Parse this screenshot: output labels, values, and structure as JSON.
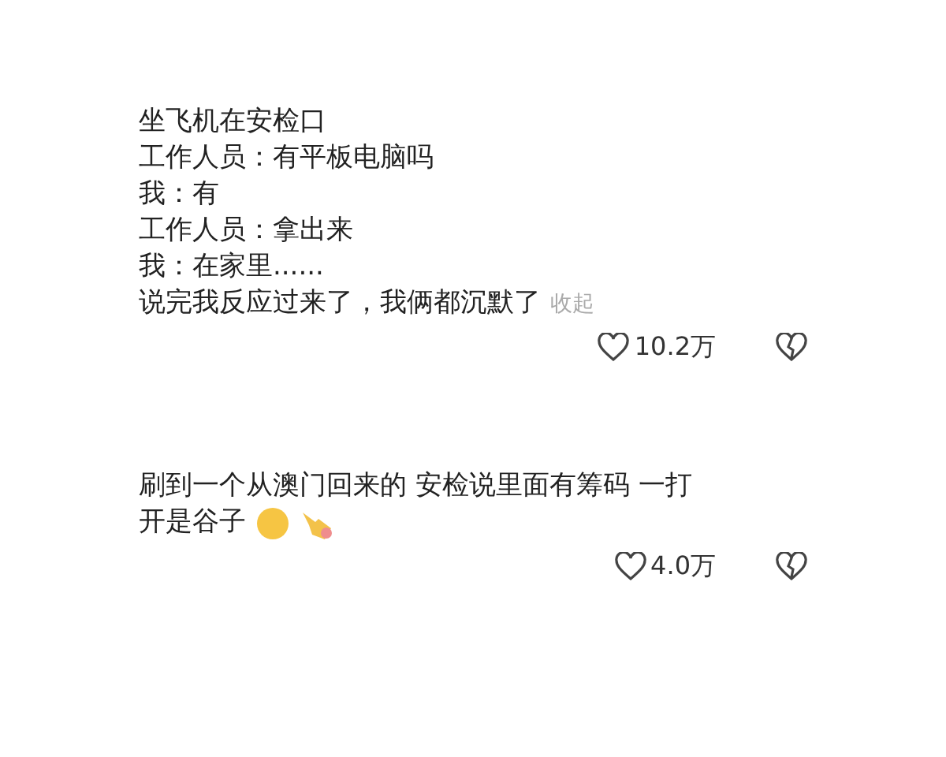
{
  "comments": [
    {
      "lines": [
        "坐飞机在安检口",
        "工作人员：有平板电脑吗",
        "我：有",
        "工作人员：拿出来",
        "我：在家里......",
        "说完我反应过来了，我俩都沉默了"
      ],
      "collapse_link": "收起",
      "likes": "10.2万"
    },
    {
      "lines": [
        "刷到一个从澳门回来的 安检说里面有筹码 一打",
        "开是谷子"
      ],
      "emojis": [
        {
          "kind": "wink"
        },
        {
          "kind": "point"
        }
      ],
      "likes": "4.0万"
    }
  ]
}
